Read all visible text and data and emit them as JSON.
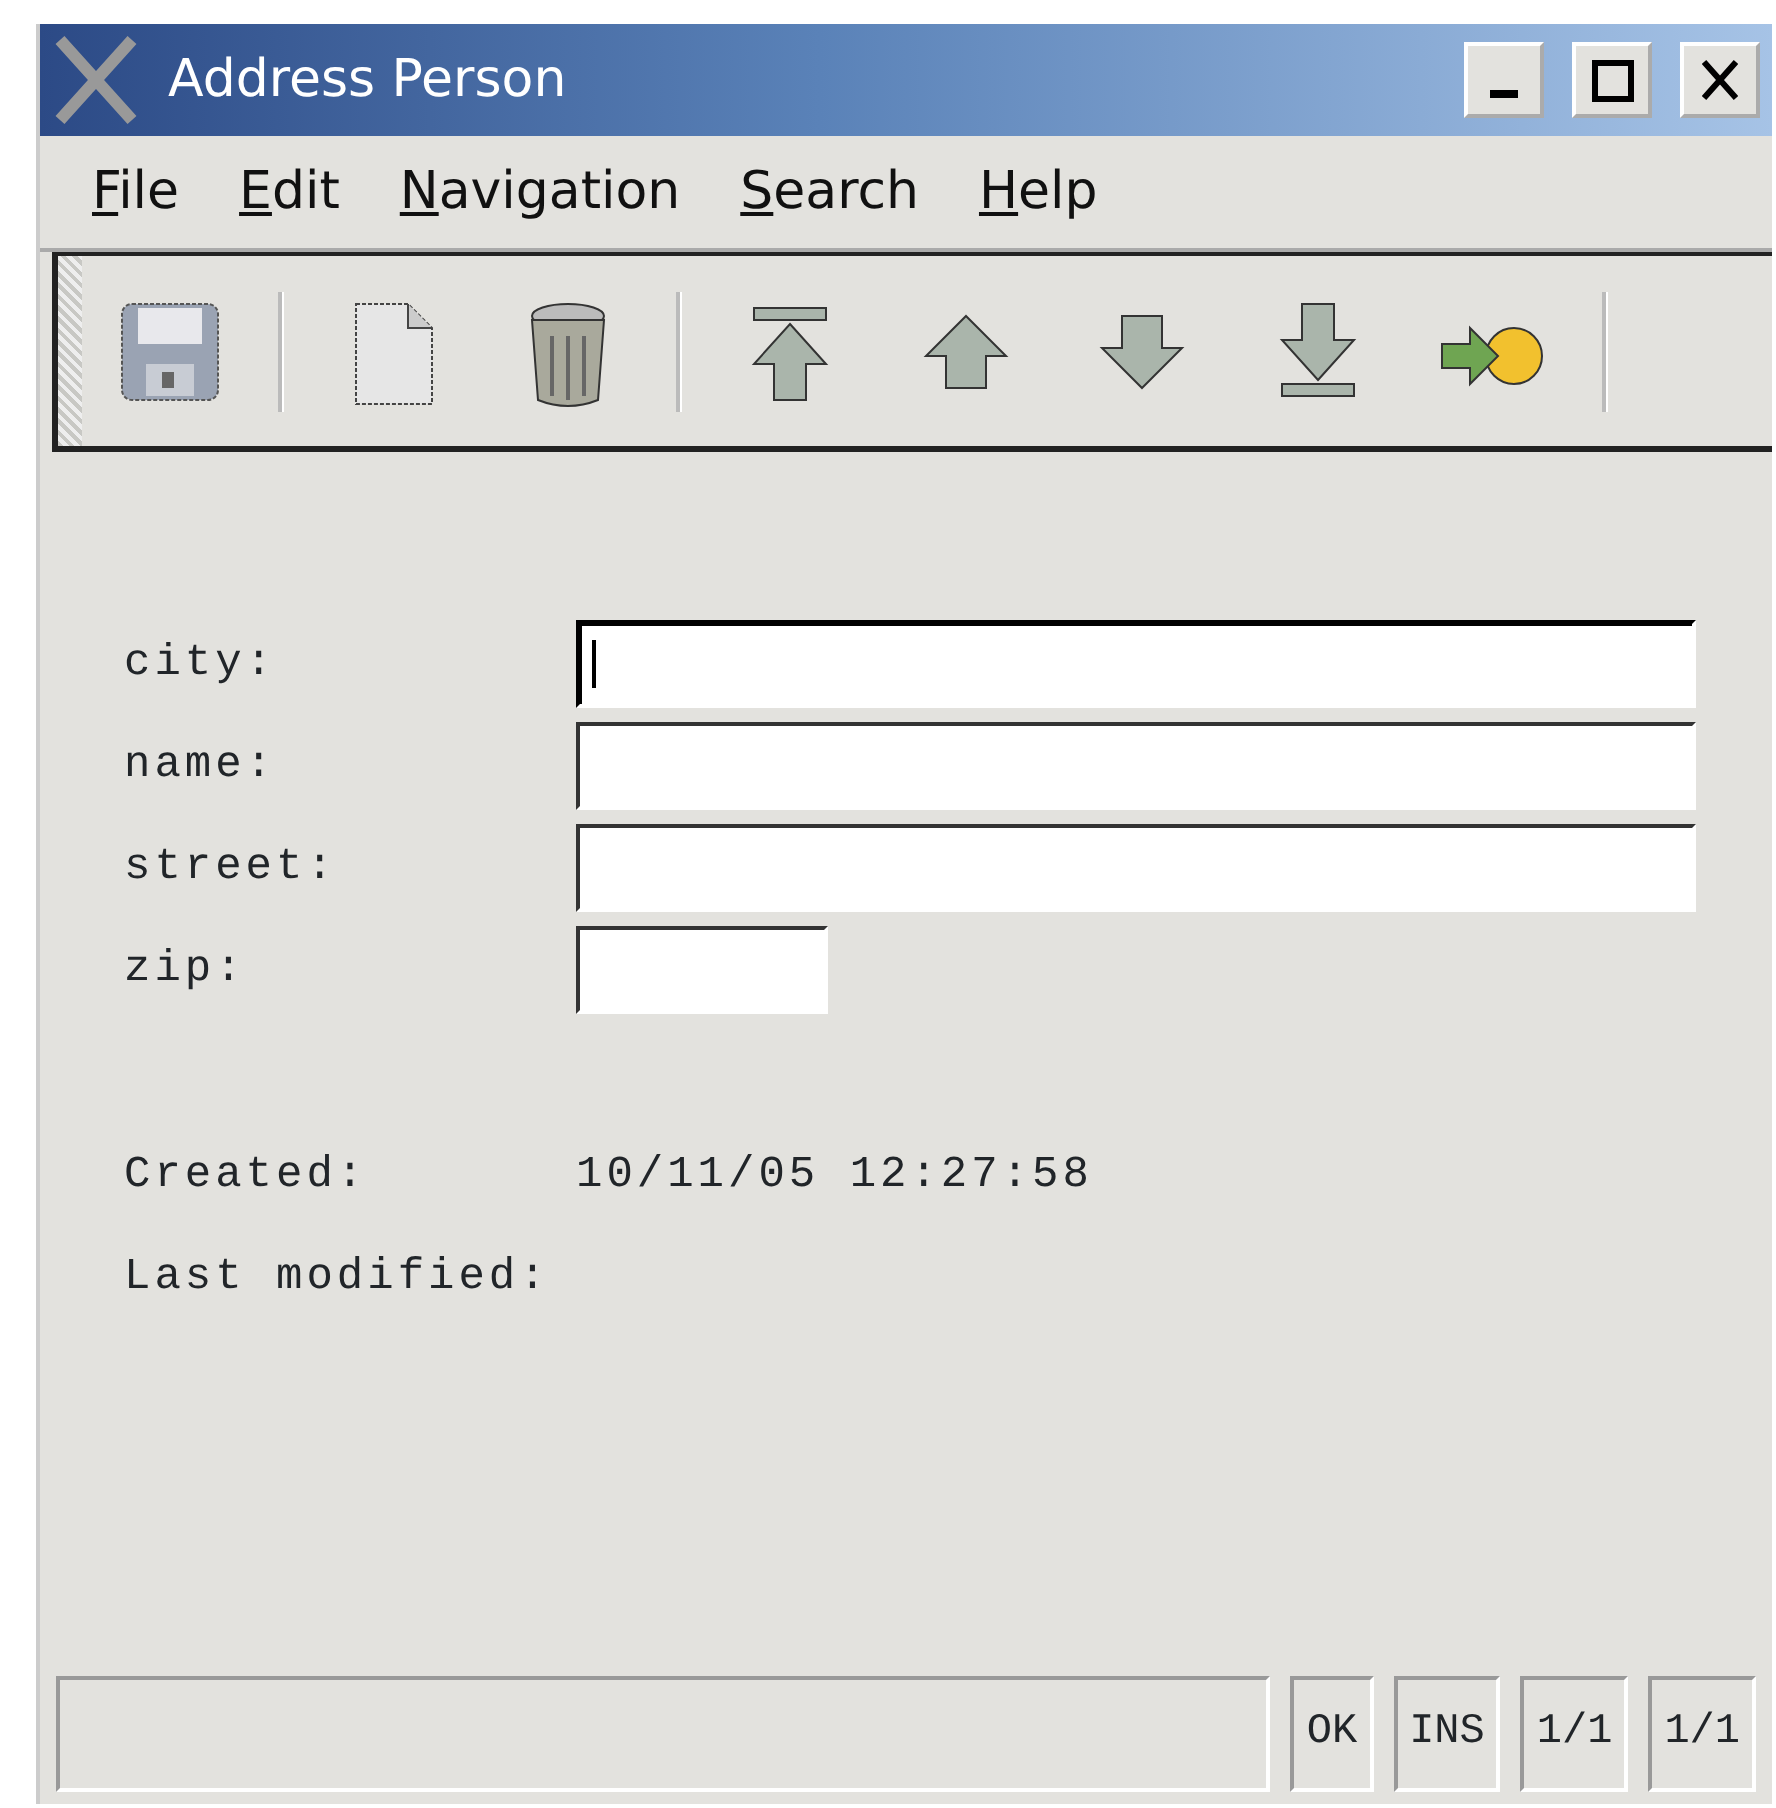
{
  "window": {
    "title": "Address Person"
  },
  "menu": [
    {
      "label": "File"
    },
    {
      "label": "Edit"
    },
    {
      "label": "Navigation"
    },
    {
      "label": "Search"
    },
    {
      "label": "Help"
    }
  ],
  "toolbar": [
    {
      "kind": "save"
    },
    {
      "kind": "separator"
    },
    {
      "kind": "new"
    },
    {
      "kind": "delete"
    },
    {
      "kind": "separator"
    },
    {
      "kind": "first"
    },
    {
      "kind": "previous"
    },
    {
      "kind": "next"
    },
    {
      "kind": "last"
    },
    {
      "kind": "go"
    },
    {
      "kind": "separator"
    }
  ],
  "fields": [
    {
      "label": "city:",
      "focused": true,
      "kind": "wide"
    },
    {
      "label": "name:",
      "focused": false,
      "kind": "wide"
    },
    {
      "label": "street:",
      "focused": false,
      "kind": "wide"
    },
    {
      "label": "zip:",
      "focused": false,
      "kind": "short"
    }
  ],
  "info": [
    {
      "label": "Created:",
      "value": "10/11/05 12:27:58"
    },
    {
      "label": "Last modified:"
    }
  ],
  "status_bar": [
    "OK",
    "INS",
    "1/1",
    "1/1"
  ]
}
